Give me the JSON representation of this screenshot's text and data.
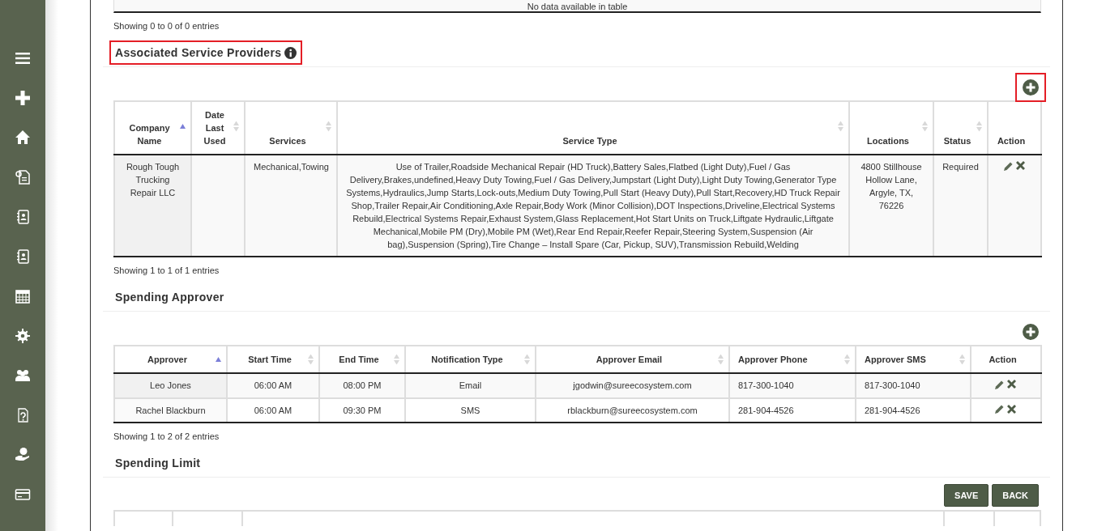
{
  "top_table": {
    "empty_text": "No data available in table",
    "footer": "Showing 0 to 0 of 0 entries"
  },
  "sections": [
    {
      "title": "Associated Service Providers",
      "info_icon": true,
      "highlighted": true,
      "add_button": {
        "highlighted": true
      },
      "table": {
        "header_bottom": true,
        "columns": [
          {
            "label": "Company Name",
            "sortable": true,
            "sorted": true,
            "kind": "text",
            "left_aligned": false
          },
          {
            "label": "Date Last Used",
            "sortable": true,
            "sorted": false,
            "kind": "text",
            "left_aligned": false
          },
          {
            "label": "Services",
            "sortable": true,
            "sorted": false,
            "kind": "text",
            "left_aligned": false
          },
          {
            "label": "Service Type",
            "sortable": true,
            "sorted": false,
            "kind": "text",
            "left_aligned": false
          },
          {
            "label": "Locations",
            "sortable": true,
            "sorted": false,
            "kind": "text",
            "left_aligned": false
          },
          {
            "label": "Status",
            "sortable": true,
            "sorted": false,
            "kind": "text",
            "left_aligned": false
          },
          {
            "label": "Action",
            "sortable": false,
            "kind": "actions",
            "left_aligned": false
          }
        ],
        "rows": [
          [
            "Rough Tough Trucking Repair LLC",
            "",
            "Mechanical,Towing",
            "Use of Trailer,Roadside Mechanical Repair (HD Truck),Battery Sales,Flatbed (Light Duty),Fuel / Gas Delivery,Brakes,undefined,Heavy Duty Towing,Fuel / Gas Delivery,Jumpstart (Light Duty),Light Duty Towing,Generator Type Systems,Hydraulics,Jump Starts,Lock-outs,Medium Duty Towing,Pull Start (Heavy Duty),Pull Start,Recovery,HD Truck Repair Shop,Trailer Repair,Air Conditioning,Axle Repair,Body Work (Minor Collision),DOT Inspections,Driveline,Electrical Systems Rebuild,Electrical Systems Repair,Exhaust System,Glass Replacement,Hot Start Units on Truck,Liftgate Hydraulic,Liftgate Mechanical,Mobile PM (Dry),Mobile PM (Wet),Rear End Repair,Reefer Repair,Steering System,Suspension (Air bag),Suspension (Spring),Tire Change – Install Spare (Car, Pickup, SUV),Transmission Rebuild,Welding",
            "4800 Stillhouse Hollow Lane, Argyle, TX, 76226",
            "Required",
            ""
          ]
        ]
      },
      "footer": "Showing 1 to 1 of 1 entries"
    },
    {
      "title": "Spending Approver",
      "info_icon": false,
      "highlighted": false,
      "add_button": {
        "highlighted": false
      },
      "table": {
        "header_bottom": false,
        "columns": [
          {
            "label": "Approver",
            "sortable": true,
            "sorted": true,
            "kind": "text",
            "left_aligned": false
          },
          {
            "label": "Start Time",
            "sortable": true,
            "sorted": false,
            "kind": "text",
            "left_aligned": false
          },
          {
            "label": "End Time",
            "sortable": true,
            "sorted": false,
            "kind": "text",
            "left_aligned": false
          },
          {
            "label": "Notification Type",
            "sortable": true,
            "sorted": false,
            "kind": "text",
            "left_aligned": false
          },
          {
            "label": "Approver Email",
            "sortable": true,
            "sorted": false,
            "kind": "text",
            "left_aligned": false
          },
          {
            "label": "Approver Phone",
            "sortable": true,
            "sorted": false,
            "kind": "text",
            "left_aligned": true
          },
          {
            "label": "Approver SMS",
            "sortable": true,
            "sorted": false,
            "kind": "text",
            "left_aligned": true
          },
          {
            "label": "Action",
            "sortable": false,
            "kind": "actions",
            "left_aligned": false
          }
        ],
        "rows": [
          [
            "Leo Jones",
            "06:00 AM",
            "08:00 PM",
            "Email",
            "jgodwin@sureecosystem.com",
            "817-300-1040",
            "817-300-1040",
            ""
          ],
          [
            "Rachel Blackburn",
            "06:00 AM",
            "09:30 PM",
            "SMS",
            "rblackburn@sureecosystem.com",
            "281-904-4526",
            "281-904-4526",
            ""
          ]
        ]
      },
      "footer": "Showing 1 to 2 of 2 entries"
    }
  ],
  "spending_limit": {
    "title": "Spending Limit",
    "buttons": [
      "SAVE",
      "BACK"
    ]
  }
}
